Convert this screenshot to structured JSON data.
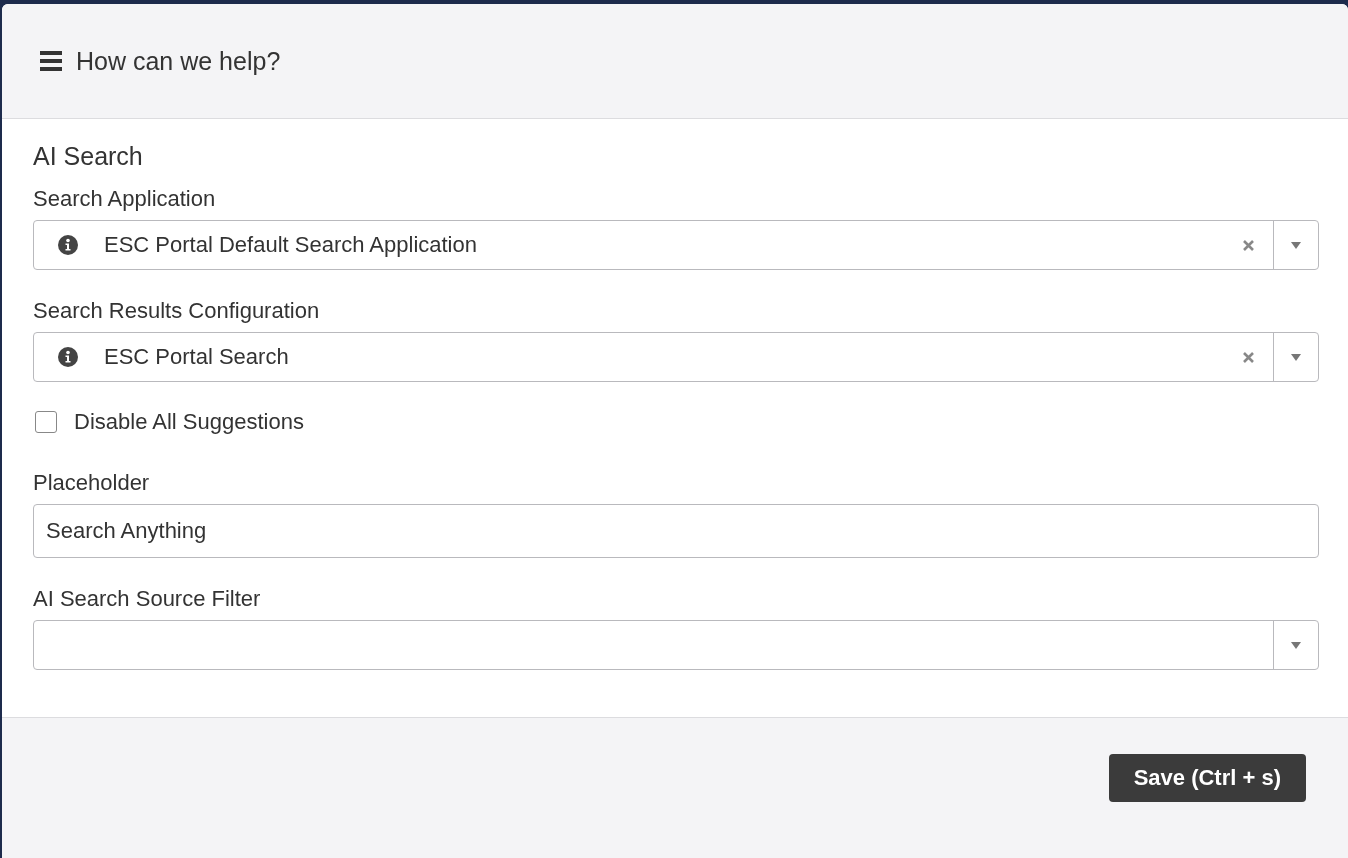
{
  "header": {
    "title": "How can we help?"
  },
  "section": {
    "title": "AI Search"
  },
  "fields": [
    {
      "kind": "select",
      "label": "Search Application",
      "value": "ESC Portal Default Search Application",
      "clearable": true
    },
    {
      "kind": "select",
      "label": "Search Results Configuration",
      "value": "ESC Portal Search",
      "clearable": true
    },
    {
      "kind": "checkbox",
      "label": "Disable All Suggestions",
      "checked": false
    },
    {
      "kind": "text",
      "label": "Placeholder",
      "value": "Search Anything"
    },
    {
      "kind": "select",
      "label": "AI Search Source Filter",
      "clearable": false
    }
  ],
  "footer": {
    "save_button": "Save (Ctrl + s)"
  }
}
